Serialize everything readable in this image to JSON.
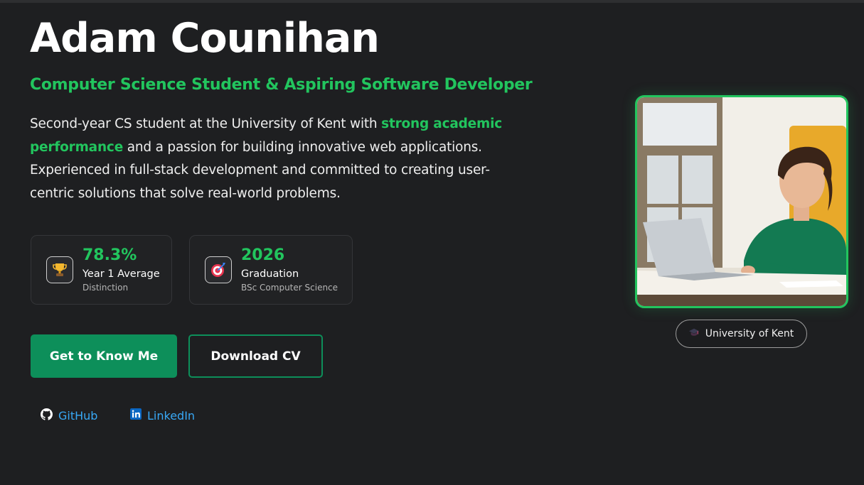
{
  "hero": {
    "name": "Adam Counihan",
    "subtitle": "Computer Science Student & Aspiring Software Developer",
    "bio": {
      "part1": "Second-year CS student at the University of Kent with ",
      "highlight": "strong academic performance",
      "part2": " and a passion for building innovative web applications. Experienced in full-stack development and committed to creating user-centric solutions that solve real-world problems."
    }
  },
  "stats": [
    {
      "icon": "trophy-icon",
      "value": "78.3%",
      "label": "Year 1 Average",
      "sub": "Distinction"
    },
    {
      "icon": "target-icon",
      "value": "2026",
      "label": "Graduation",
      "sub": "BSc Computer Science"
    }
  ],
  "buttons": {
    "primary": "Get to Know Me",
    "secondary": "Download CV"
  },
  "social": {
    "github": "GitHub",
    "linkedin": "LinkedIn"
  },
  "photo_badge": {
    "icon": "graduation-cap-icon",
    "label": "University of Kent"
  },
  "colors": {
    "accent": "#22c55e",
    "button": "#0d8f5a",
    "link": "#38a8f5",
    "background": "#1e1f21"
  }
}
